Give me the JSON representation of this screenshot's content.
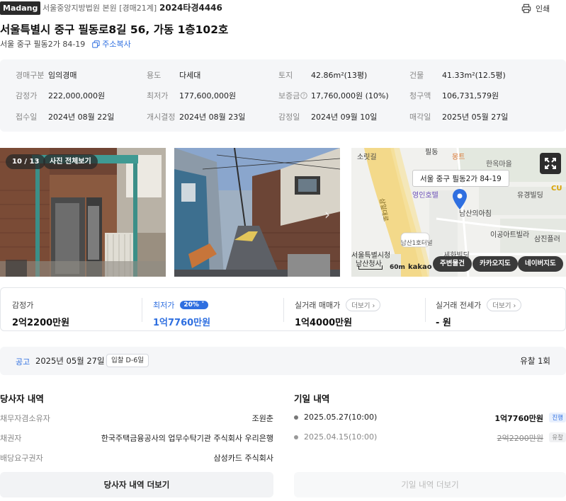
{
  "header": {
    "brand": "Madang",
    "court": "서울중앙지방법원 본원 [경매21계]",
    "case_no": "2024타경4446",
    "print_label": "인쇄",
    "title": "서울특별시 중구 필동로8길 56, 가동 1층102호",
    "jibun": "서울 중구 필동2가 84-19",
    "copy_label": "주소복사"
  },
  "info": [
    {
      "label": "경매구분",
      "value": "임의경매"
    },
    {
      "label": "용도",
      "value": "다세대"
    },
    {
      "label": "토지",
      "value": "42.86m²(13평)"
    },
    {
      "label": "건물",
      "value": "41.33m²(12.5평)"
    },
    {
      "label": "감정가",
      "value": "222,000,000원"
    },
    {
      "label": "최저가",
      "value": "177,600,000원"
    },
    {
      "label": "보증금",
      "value": "17,760,000원 (10%)"
    },
    {
      "label": "청구액",
      "value": "106,731,579원"
    },
    {
      "label": "접수일",
      "value": "2024년 08월 22일"
    },
    {
      "label": "개시결정",
      "value": "2024년 08월 23일"
    },
    {
      "label": "감정일",
      "value": "2024년 09월 10일"
    },
    {
      "label": "매각일",
      "value": "2025년 05월 27일"
    }
  ],
  "photos": {
    "counter": "10 / 13",
    "view_all": "사진 전체보기"
  },
  "map": {
    "tooltip": "서울 중구 필동2가 84-19",
    "labels": [
      "소릿길",
      "필동",
      "몽트",
      "한옥마을",
      "영인호텔",
      "남산의아침",
      "유경빌딩",
      "삼일대로",
      "남산1호터널",
      "이공아트빌라",
      "세화빌딩",
      "서울특별시청",
      "남산청사",
      "삼진플러",
      "CU"
    ],
    "scale": "60m",
    "kakao": "kakao",
    "btn_nearby": "주변물건",
    "btn_kakao": "카카오지도",
    "btn_naver": "네이버지도"
  },
  "prices": {
    "appraisal_label": "감정가",
    "appraisal_value": "2억2200만원",
    "minimum_label": "최저가",
    "minimum_badge": "20%",
    "minimum_value": "1억7760만원",
    "trade_label": "실거래 매매가",
    "trade_more": "더보기",
    "trade_value": "1억4000만원",
    "rent_label": "실거래 전세가",
    "rent_more": "더보기",
    "rent_value": "- 원"
  },
  "notice": {
    "label": "공고",
    "date": "2025년 05월 27일",
    "dday": "입찰 D-6일",
    "fail": "유찰 1회"
  },
  "parties": {
    "title": "당사자 내역",
    "rows": [
      {
        "role": "채무자겸소유자",
        "name": "조원춘"
      },
      {
        "role": "채권자",
        "name": "한국주택금융공사의 업무수탁기관 주식회사 우리은행"
      },
      {
        "role": "배당요구권자",
        "name": "삼성카드 주식회사"
      }
    ],
    "more": "당사자 내역 더보기"
  },
  "history": {
    "title": "기일 내역",
    "rows": [
      {
        "date": "2025.05.27(10:00)",
        "amount": "1억7760만원",
        "status": "진행"
      },
      {
        "date": "2025.04.15(10:00)",
        "amount": "2억2200만원",
        "status": "유찰"
      }
    ],
    "more": "기일 내역 더보기"
  },
  "colors": {
    "accent": "#2f6fe0",
    "map_pin": "#2f6fe0"
  }
}
